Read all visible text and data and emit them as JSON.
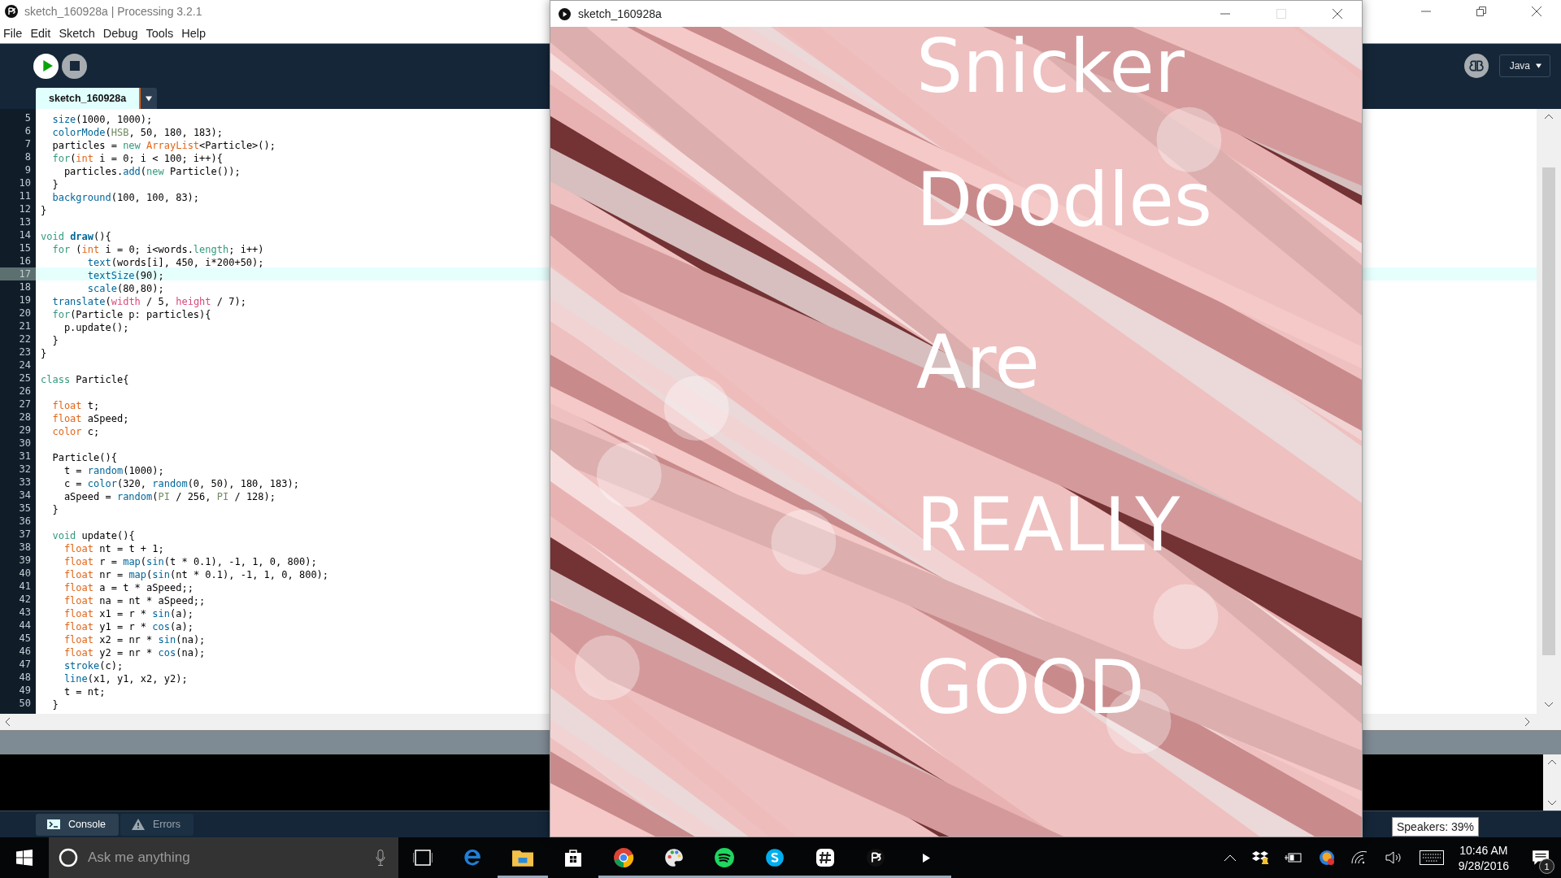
{
  "window": {
    "title": "sketch_160928a | Processing 3.2.1"
  },
  "menu": [
    "File",
    "Edit",
    "Sketch",
    "Debug",
    "Tools",
    "Help"
  ],
  "toolbar": {
    "mode": "Java"
  },
  "tabs": [
    {
      "label": "sketch_160928a",
      "selected": true
    }
  ],
  "editor": {
    "lines": [
      {
        "number": "5",
        "selected": false,
        "tokens": [
          {
            "text": "  size",
            "kind": "fn"
          },
          {
            "text": "(1000, 1000);",
            "kind": "plain"
          }
        ]
      },
      {
        "number": "6",
        "selected": false,
        "tokens": [
          {
            "text": "  colorMode",
            "kind": "fn"
          },
          {
            "text": "(",
            "kind": "plain"
          },
          {
            "text": "HSB",
            "kind": "const"
          },
          {
            "text": ", 50, 180, 183);",
            "kind": "plain"
          }
        ]
      },
      {
        "number": "7",
        "selected": false,
        "tokens": [
          {
            "text": "  particles =",
            "kind": "plain"
          },
          {
            "text": " new",
            "kind": "kw"
          },
          {
            "text": " ArrayList",
            "kind": "type"
          },
          {
            "text": "<Particle>();",
            "kind": "plain"
          }
        ]
      },
      {
        "number": "8",
        "selected": false,
        "tokens": [
          {
            "text": "  for",
            "kind": "kw"
          },
          {
            "text": "(",
            "kind": "plain"
          },
          {
            "text": "int",
            "kind": "type"
          },
          {
            "text": " i = 0; i < 100; i++){",
            "kind": "plain"
          }
        ]
      },
      {
        "number": "9",
        "selected": false,
        "tokens": [
          {
            "text": "    particles.",
            "kind": "plain"
          },
          {
            "text": "add",
            "kind": "fn"
          },
          {
            "text": "(",
            "kind": "plain"
          },
          {
            "text": "new",
            "kind": "kw"
          },
          {
            "text": " Particle());",
            "kind": "plain"
          }
        ]
      },
      {
        "number": "10",
        "selected": false,
        "tokens": [
          {
            "text": "  }",
            "kind": "plain"
          }
        ]
      },
      {
        "number": "11",
        "selected": false,
        "tokens": [
          {
            "text": "  background",
            "kind": "fn"
          },
          {
            "text": "(100, 100, 83);",
            "kind": "plain"
          }
        ]
      },
      {
        "number": "12",
        "selected": false,
        "tokens": [
          {
            "text": "}",
            "kind": "plain"
          }
        ]
      },
      {
        "number": "13",
        "selected": false
      },
      {
        "number": "14",
        "selected": false,
        "tokens": [
          {
            "text": "void",
            "kind": "kw"
          },
          {
            "text": " draw",
            "kind": "fnb"
          },
          {
            "text": "(){",
            "kind": "plain"
          }
        ]
      },
      {
        "number": "15",
        "selected": false,
        "tokens": [
          {
            "text": "  for",
            "kind": "kw"
          },
          {
            "text": " (",
            "kind": "plain"
          },
          {
            "text": "int",
            "kind": "type"
          },
          {
            "text": " i = 0; i<words.",
            "kind": "plain"
          },
          {
            "text": "length",
            "kind": "kw"
          },
          {
            "text": "; i++)",
            "kind": "plain"
          }
        ]
      },
      {
        "number": "16",
        "selected": false,
        "tokens": [
          {
            "text": "        text",
            "kind": "fn"
          },
          {
            "text": "(words[i], 450, i*200+50);",
            "kind": "plain"
          }
        ]
      },
      {
        "number": "17",
        "selected": true,
        "tokens": [
          {
            "text": "        textSize",
            "kind": "fn"
          },
          {
            "text": "(90);",
            "kind": "plain"
          }
        ]
      },
      {
        "number": "18",
        "selected": false,
        "tokens": [
          {
            "text": "        scale",
            "kind": "fn"
          },
          {
            "text": "(80,80);",
            "kind": "plain"
          }
        ]
      },
      {
        "number": "19",
        "selected": false,
        "tokens": [
          {
            "text": "  translate",
            "kind": "fn"
          },
          {
            "text": "(",
            "kind": "plain"
          },
          {
            "text": "width",
            "kind": "var"
          },
          {
            "text": " / 5, ",
            "kind": "plain"
          },
          {
            "text": "height",
            "kind": "var"
          },
          {
            "text": " / 7);",
            "kind": "plain"
          }
        ]
      },
      {
        "number": "20",
        "selected": false,
        "tokens": [
          {
            "text": "  for",
            "kind": "kw"
          },
          {
            "text": "(Particle p: particles){",
            "kind": "plain"
          }
        ]
      },
      {
        "number": "21",
        "selected": false,
        "tokens": [
          {
            "text": "    p.update();",
            "kind": "plain"
          }
        ]
      },
      {
        "number": "22",
        "selected": false,
        "tokens": [
          {
            "text": "  }",
            "kind": "plain"
          }
        ]
      },
      {
        "number": "23",
        "selected": false,
        "tokens": [
          {
            "text": "}",
            "kind": "plain"
          }
        ]
      },
      {
        "number": "24",
        "selected": false
      },
      {
        "number": "25",
        "selected": false,
        "tokens": [
          {
            "text": "class",
            "kind": "kw"
          },
          {
            "text": " Particle{",
            "kind": "plain"
          }
        ]
      },
      {
        "number": "26",
        "selected": false
      },
      {
        "number": "27",
        "selected": false,
        "tokens": [
          {
            "text": "  float",
            "kind": "type"
          },
          {
            "text": " t;",
            "kind": "plain"
          }
        ]
      },
      {
        "number": "28",
        "selected": false,
        "tokens": [
          {
            "text": "  float",
            "kind": "type"
          },
          {
            "text": " aSpeed;",
            "kind": "plain"
          }
        ]
      },
      {
        "number": "29",
        "selected": false,
        "tokens": [
          {
            "text": "  color",
            "kind": "type"
          },
          {
            "text": " c;",
            "kind": "plain"
          }
        ]
      },
      {
        "number": "30",
        "selected": false
      },
      {
        "number": "31",
        "selected": false,
        "tokens": [
          {
            "text": "  Particle(){",
            "kind": "plain"
          }
        ]
      },
      {
        "number": "32",
        "selected": false,
        "tokens": [
          {
            "text": "    t = ",
            "kind": "plain"
          },
          {
            "text": "random",
            "kind": "fn"
          },
          {
            "text": "(1000);",
            "kind": "plain"
          }
        ]
      },
      {
        "number": "33",
        "selected": false,
        "tokens": [
          {
            "text": "    c = ",
            "kind": "plain"
          },
          {
            "text": "color",
            "kind": "fn"
          },
          {
            "text": "(320, ",
            "kind": "plain"
          },
          {
            "text": "random",
            "kind": "fn"
          },
          {
            "text": "(0, 50), 180, 183);",
            "kind": "plain"
          }
        ]
      },
      {
        "number": "34",
        "selected": false,
        "tokens": [
          {
            "text": "    aSpeed = ",
            "kind": "plain"
          },
          {
            "text": "random",
            "kind": "fn"
          },
          {
            "text": "(",
            "kind": "plain"
          },
          {
            "text": "PI",
            "kind": "const"
          },
          {
            "text": " / 256, ",
            "kind": "plain"
          },
          {
            "text": "PI",
            "kind": "const"
          },
          {
            "text": " / 128);",
            "kind": "plain"
          }
        ]
      },
      {
        "number": "35",
        "selected": false,
        "tokens": [
          {
            "text": "  }",
            "kind": "plain"
          }
        ]
      },
      {
        "number": "36",
        "selected": false
      },
      {
        "number": "37",
        "selected": false,
        "tokens": [
          {
            "text": "  void",
            "kind": "kw"
          },
          {
            "text": " update(){",
            "kind": "plain"
          }
        ]
      },
      {
        "number": "38",
        "selected": false,
        "tokens": [
          {
            "text": "    float",
            "kind": "type"
          },
          {
            "text": " nt = t + 1;",
            "kind": "plain"
          }
        ]
      },
      {
        "number": "39",
        "selected": false,
        "tokens": [
          {
            "text": "    float",
            "kind": "type"
          },
          {
            "text": " r = ",
            "kind": "plain"
          },
          {
            "text": "map",
            "kind": "fn"
          },
          {
            "text": "(",
            "kind": "plain"
          },
          {
            "text": "sin",
            "kind": "fn"
          },
          {
            "text": "(t * 0.1), -1, 1, 0, 800);",
            "kind": "plain"
          }
        ]
      },
      {
        "number": "40",
        "selected": false,
        "tokens": [
          {
            "text": "    float",
            "kind": "type"
          },
          {
            "text": " nr = ",
            "kind": "plain"
          },
          {
            "text": "map",
            "kind": "fn"
          },
          {
            "text": "(",
            "kind": "plain"
          },
          {
            "text": "sin",
            "kind": "fn"
          },
          {
            "text": "(nt * 0.1), -1, 1, 0, 800);",
            "kind": "plain"
          }
        ]
      },
      {
        "number": "41",
        "selected": false,
        "tokens": [
          {
            "text": "    float",
            "kind": "type"
          },
          {
            "text": " a = t * aSpeed;;",
            "kind": "plain"
          }
        ]
      },
      {
        "number": "42",
        "selected": false,
        "tokens": [
          {
            "text": "    float",
            "kind": "type"
          },
          {
            "text": " na = nt * aSpeed;;",
            "kind": "plain"
          }
        ]
      },
      {
        "number": "43",
        "selected": false,
        "tokens": [
          {
            "text": "    float",
            "kind": "type"
          },
          {
            "text": " x1 = r * ",
            "kind": "plain"
          },
          {
            "text": "sin",
            "kind": "fn"
          },
          {
            "text": "(a);",
            "kind": "plain"
          }
        ]
      },
      {
        "number": "44",
        "selected": false,
        "tokens": [
          {
            "text": "    float",
            "kind": "type"
          },
          {
            "text": " y1 = r * ",
            "kind": "plain"
          },
          {
            "text": "cos",
            "kind": "fn"
          },
          {
            "text": "(a);",
            "kind": "plain"
          }
        ]
      },
      {
        "number": "45",
        "selected": false,
        "tokens": [
          {
            "text": "    float",
            "kind": "type"
          },
          {
            "text": " x2 = nr * ",
            "kind": "plain"
          },
          {
            "text": "sin",
            "kind": "fn"
          },
          {
            "text": "(na);",
            "kind": "plain"
          }
        ]
      },
      {
        "number": "46",
        "selected": false,
        "tokens": [
          {
            "text": "    float",
            "kind": "type"
          },
          {
            "text": " y2 = nr * ",
            "kind": "plain"
          },
          {
            "text": "cos",
            "kind": "fn"
          },
          {
            "text": "(na);",
            "kind": "plain"
          }
        ]
      },
      {
        "number": "47",
        "selected": false,
        "tokens": [
          {
            "text": "    stroke",
            "kind": "fn"
          },
          {
            "text": "(c);",
            "kind": "plain"
          }
        ]
      },
      {
        "number": "48",
        "selected": false,
        "tokens": [
          {
            "text": "    line",
            "kind": "fn"
          },
          {
            "text": "(x1, y1, x2, y2);",
            "kind": "plain"
          }
        ]
      },
      {
        "number": "49",
        "selected": false,
        "tokens": [
          {
            "text": "    t = nt;",
            "kind": "plain"
          }
        ]
      },
      {
        "number": "50",
        "selected": false,
        "tokens": [
          {
            "text": "  }",
            "kind": "plain"
          }
        ]
      }
    ]
  },
  "console_tabs": [
    {
      "label": "Console",
      "kind": "console",
      "selected": true
    },
    {
      "label": "Errors",
      "kind": "errors",
      "selected": false
    }
  ],
  "sketch_window": {
    "title": "sketch_160928a",
    "words": [
      "Snicker",
      "Doodles",
      "Are",
      "REALLY",
      "GOOD"
    ]
  },
  "taskbar": {
    "search": {
      "placeholder": "Ask me anything"
    },
    "apps": [
      {
        "kind": "edge",
        "running": false
      },
      {
        "kind": "explorer",
        "running": true
      },
      {
        "kind": "store",
        "running": false
      },
      {
        "kind": "chrome",
        "running": true
      },
      {
        "kind": "palette",
        "running": true
      },
      {
        "kind": "spotify",
        "running": true
      },
      {
        "kind": "skype",
        "running": true
      },
      {
        "kind": "slack",
        "running": true
      },
      {
        "kind": "processing",
        "running": true
      },
      {
        "kind": "play",
        "running": true
      }
    ],
    "tooltip": "Speakers: 39%",
    "clock": {
      "time": "10:46 AM",
      "date": "9/28/2016"
    },
    "notifications": {
      "count": "1"
    }
  }
}
